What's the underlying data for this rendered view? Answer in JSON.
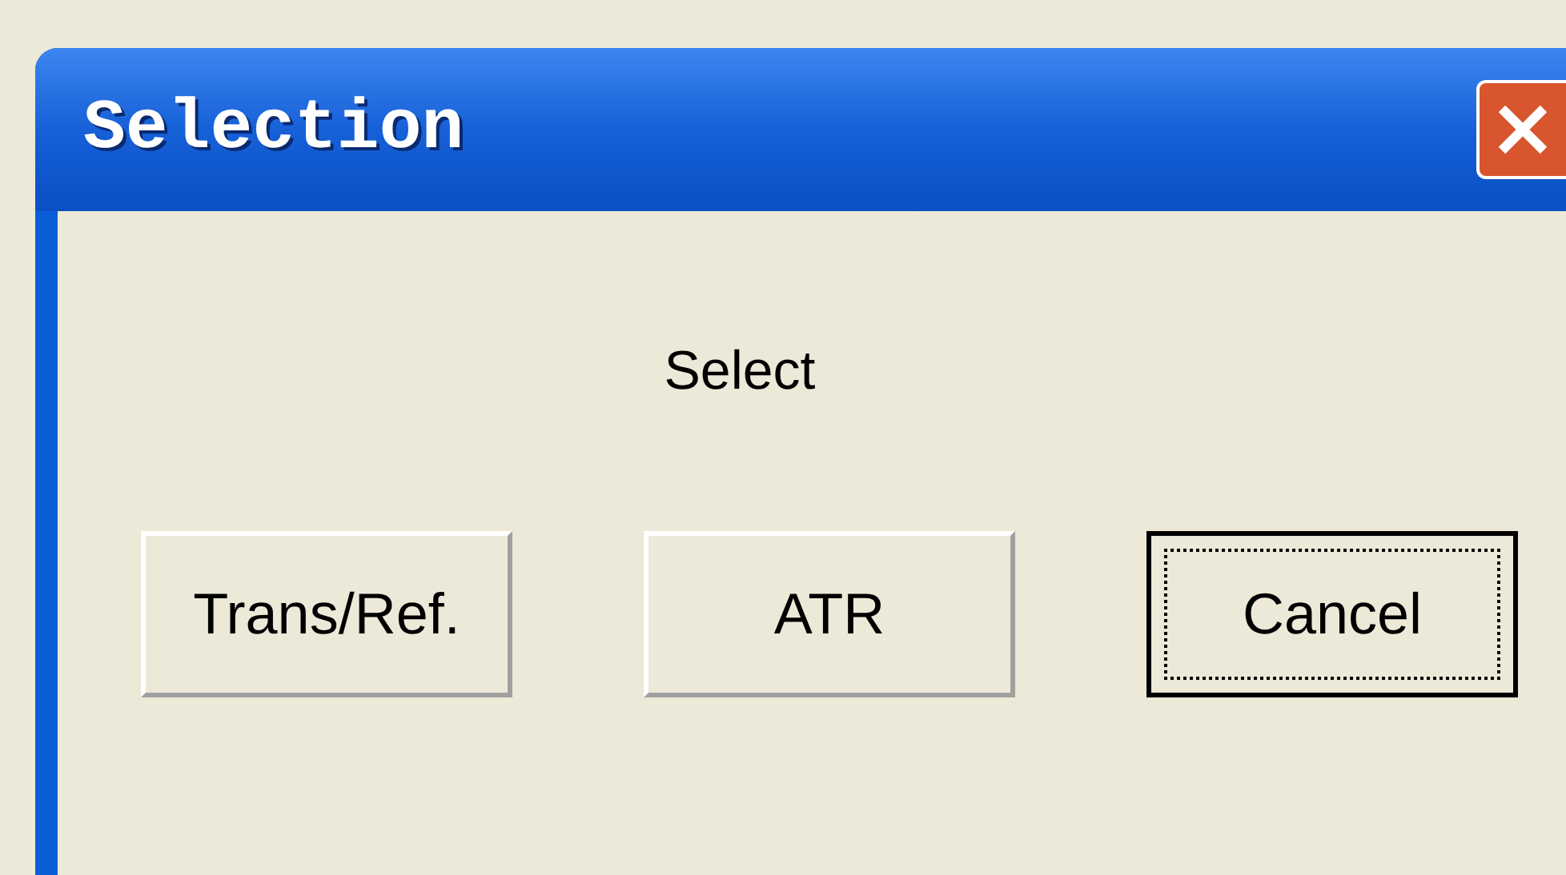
{
  "window": {
    "title": "Selection"
  },
  "message": "Select",
  "buttons": [
    {
      "label": "Trans/Ref.",
      "focused": false
    },
    {
      "label": "ATR",
      "focused": false
    },
    {
      "label": "Cancel",
      "focused": true
    }
  ]
}
